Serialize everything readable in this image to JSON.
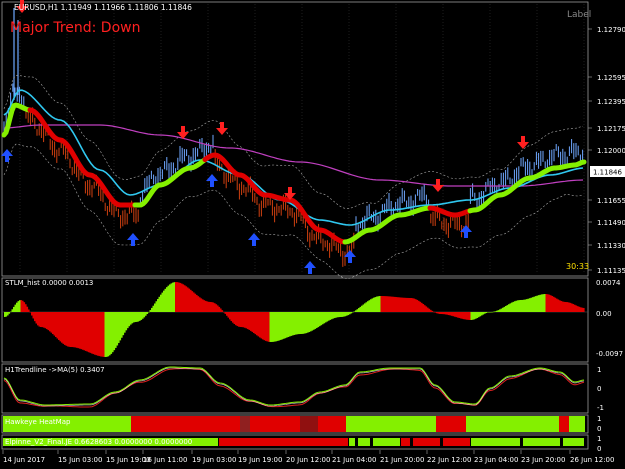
{
  "main": {
    "symbol_info": "EURUSD,H1  1.11949 1.11966 1.11806 1.11846",
    "trend_label": "Major Trend: Down",
    "corner_label": "Label",
    "countdown": "30:33",
    "current_price": "1.11846",
    "price_ticks": [
      "1.12790",
      "1.12595",
      "1.12395",
      "1.12350",
      "1.12175",
      "1.12000",
      "1.11846",
      "1.11655",
      "1.11490",
      "1.11330",
      "1.11135"
    ]
  },
  "panels": {
    "stlm": {
      "title": "STLM_hist 0.0000 0.0013",
      "ticks": [
        "0.0074",
        "0.00",
        "-0.0097"
      ]
    },
    "h1": {
      "title": "H1Trendline  ->MA(5) 0.3407",
      "ticks": [
        "1",
        "0",
        "-1"
      ]
    },
    "heatmap": {
      "title": "Hawkeye HeatMap",
      "ticks": [
        "1",
        "0"
      ]
    },
    "elpinne": {
      "title": "Elpinne_V2_Final.JE 0.6628603 0.0000000 0.0000000",
      "ticks": [
        "1",
        "0"
      ]
    }
  },
  "time_axis": [
    "14 Jun 2017",
    "15 Jun 03:00",
    "15 Jun 19:00",
    "16 Jun 11:00",
    "19 Jun 03:00",
    "19 Jun 19:00",
    "20 Jun 12:00",
    "21 Jun 04:00",
    "21 Jun 20:00",
    "22 Jun 12:00",
    "23 Jun 04:00",
    "23 Jun 20:00",
    "26 Jun 12:00"
  ],
  "colors": {
    "background": "#000000",
    "up": "#84f000",
    "down": "#e00000",
    "price_bars_up": "#6fa8ff",
    "price_bars_down": "#d04010",
    "ma_cyan": "#30c8f0",
    "ma_magenta": "#c040c0",
    "signal_up_arrow": "#2050ff",
    "signal_down_arrow": "#ff2020",
    "countdown": "#ffe000",
    "trend_text": "#ff2020"
  },
  "icons": {
    "sell_arrow": "down-arrow-icon",
    "buy_arrow": "up-arrow-icon"
  }
}
